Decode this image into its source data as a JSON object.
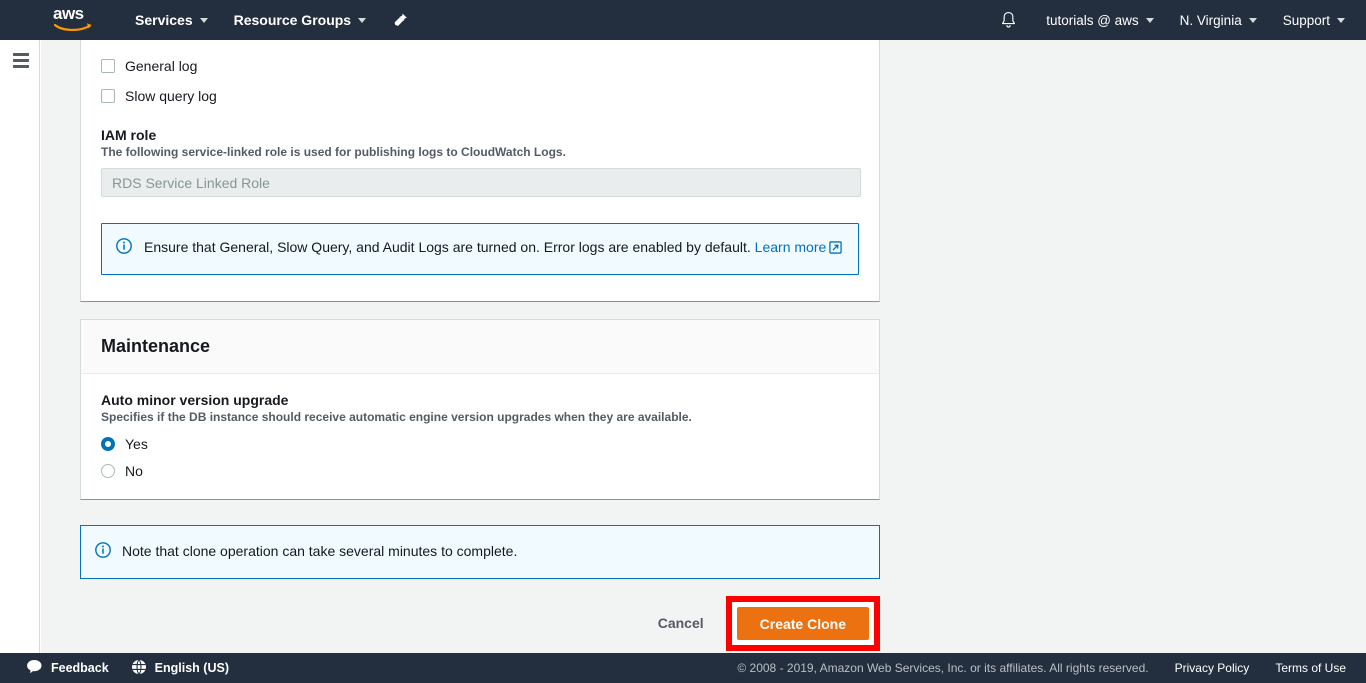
{
  "topnav": {
    "logo_text": "aws",
    "logo_name": "aws-logo",
    "items": [
      {
        "label": "Services",
        "icon": "chevron-down-icon"
      },
      {
        "label": "Resource Groups",
        "icon": "chevron-down-icon"
      }
    ],
    "pin_icon": "pin-icon",
    "bell_icon": "bell-notification-icon",
    "account": "tutorials @ aws",
    "region": "N. Virginia",
    "support": "Support"
  },
  "sidebar": {
    "menu_icon": "hamburger-menu-icon"
  },
  "logs_card": {
    "checkboxes": [
      {
        "label": "General log",
        "checked": false
      },
      {
        "label": "Slow query log",
        "checked": false
      }
    ],
    "iam_role": {
      "label": "IAM role",
      "description": "The following service-linked role is used for publishing logs to CloudWatch Logs.",
      "value": "RDS Service Linked Role"
    },
    "alert": {
      "icon": "info-circle-icon",
      "text": "Ensure that General, Slow Query, and Audit Logs are turned on. Error logs are enabled by default. ",
      "link_text": "Learn more",
      "link_icon": "external-link-icon"
    }
  },
  "maintenance_card": {
    "title": "Maintenance",
    "setting": {
      "label": "Auto minor version upgrade",
      "description": "Specifies if the DB instance should receive automatic engine version upgrades when they are available.",
      "options": [
        {
          "label": "Yes",
          "selected": true
        },
        {
          "label": "No",
          "selected": false
        }
      ]
    }
  },
  "note": {
    "icon": "info-circle-icon",
    "text": "Note that clone operation can take several minutes to complete."
  },
  "actions": {
    "cancel_label": "Cancel",
    "create_label": "Create Clone",
    "highlight_color": "#ff0000"
  },
  "footer": {
    "feedback_label": "Feedback",
    "feedback_icon": "speech-bubble-icon",
    "language_label": "English (US)",
    "language_icon": "globe-icon",
    "copyright": "© 2008 - 2019, Amazon Web Services, Inc. or its affiliates. All rights reserved.",
    "privacy_label": "Privacy Policy",
    "terms_label": "Terms of Use"
  },
  "colors": {
    "nav_background": "#232f3e",
    "page_background": "#f2f3f3",
    "accent_orange": "#ec7211",
    "link_blue": "#0073bb",
    "alert_background": "#f1faff"
  }
}
